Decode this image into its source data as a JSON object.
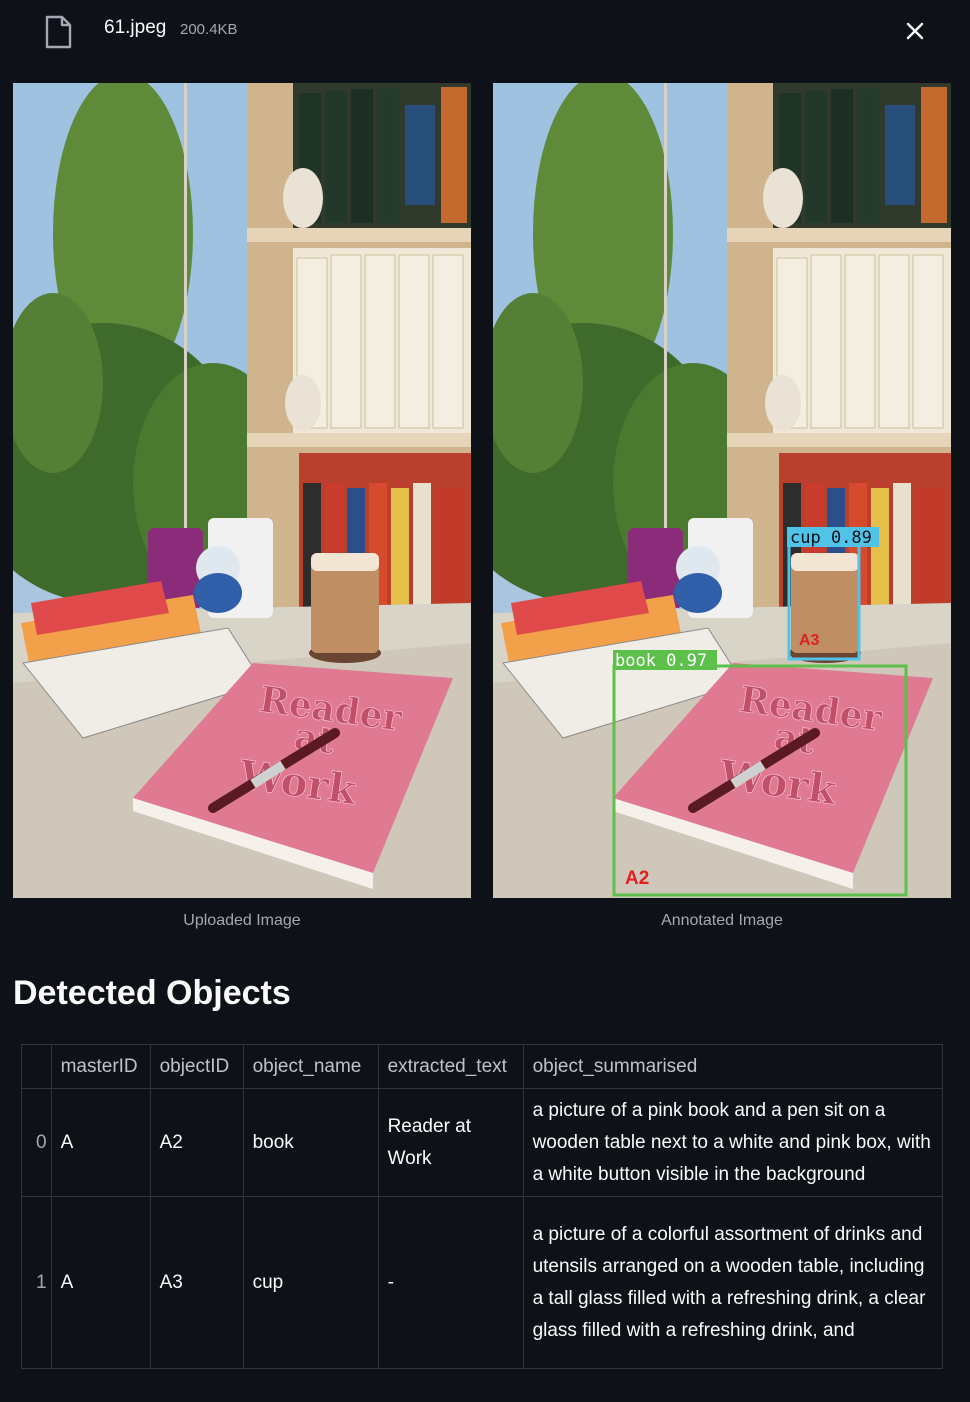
{
  "file": {
    "name": "61.jpeg",
    "size": "200.4KB"
  },
  "images": {
    "uploaded_caption": "Uploaded Image",
    "annotated_caption": "Annotated Image",
    "cover_title_1": "Reader",
    "cover_title_2": "at",
    "cover_title_3": "Work",
    "detections": [
      {
        "label": "cup 0.89",
        "id": "A3",
        "color": "#4fc3e8"
      },
      {
        "label": "book 0.97",
        "id": "A2",
        "color": "#5cc04a"
      }
    ]
  },
  "section_title": "Detected Objects",
  "table": {
    "columns": [
      "",
      "masterID",
      "objectID",
      "object_name",
      "extracted_text",
      "object_summarised"
    ],
    "rows": [
      {
        "index": "0",
        "masterID": "A",
        "objectID": "A2",
        "object_name": "book",
        "extracted_text": "Reader at Work",
        "object_summarised": "a picture of a pink book and a pen sit on a wooden table next to a white and pink box, with a white button visible in the background"
      },
      {
        "index": "1",
        "masterID": "A",
        "objectID": "A3",
        "object_name": "cup",
        "extracted_text": "-",
        "object_summarised": "a picture of a colorful assortment of drinks and utensils arranged on a wooden table, including a tall glass filled with a refreshing drink, a clear glass filled with a refreshing drink, and"
      }
    ]
  },
  "colors": {
    "background": "#0e1117",
    "text": "#fafafa",
    "muted": "#a3a8b4",
    "border": "#31333f",
    "book_box": "#5cc04a",
    "cup_box": "#4fc3e8",
    "id_label": "#e02020"
  }
}
